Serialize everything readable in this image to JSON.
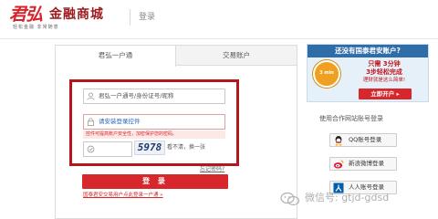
{
  "header": {
    "logo_brand": "君弘",
    "logo_name": "金融商城",
    "logo_slogan": "轻松金融 非常随意",
    "page_title": "登录"
  },
  "tabs": [
    {
      "label": "君弘一户通",
      "active": true
    },
    {
      "label": "交易账户",
      "active": false
    }
  ],
  "form": {
    "username_placeholder": "君弘一户通号/身份证号/昵称",
    "password_placeholder": "请安装登录控件",
    "password_tip": "控件可提高账户安全性，加密保护您的密码。",
    "captcha_code": "5978",
    "captcha_refresh": "看不清，换一张",
    "forgot_link": "忘记密码?",
    "login_button": "登 录",
    "switch_link": "国泰君安交易用户点此登录一户通 »"
  },
  "promo": {
    "heading": "还没有国泰君安账户?",
    "badge": "3 min",
    "line1": "只需 3分钟",
    "line2": "3步轻松完成",
    "line3": "理财就是这么简单!",
    "open_button": "立即开户 ▸"
  },
  "partners": {
    "title": "使用合作网站账号登录",
    "buttons": [
      {
        "label": "QQ账号登录",
        "icon": "qq-icon"
      },
      {
        "label": "新浪微博登录",
        "icon": "weibo-icon"
      },
      {
        "label": "人人账号登录",
        "icon": "renren-icon"
      }
    ]
  },
  "watermark": {
    "text": "微信号: gtjd-gdsd"
  },
  "colors": {
    "brand_red": "#d7262c",
    "highlight_box": "#b5151b",
    "promo_blue": "#2f6da8"
  }
}
